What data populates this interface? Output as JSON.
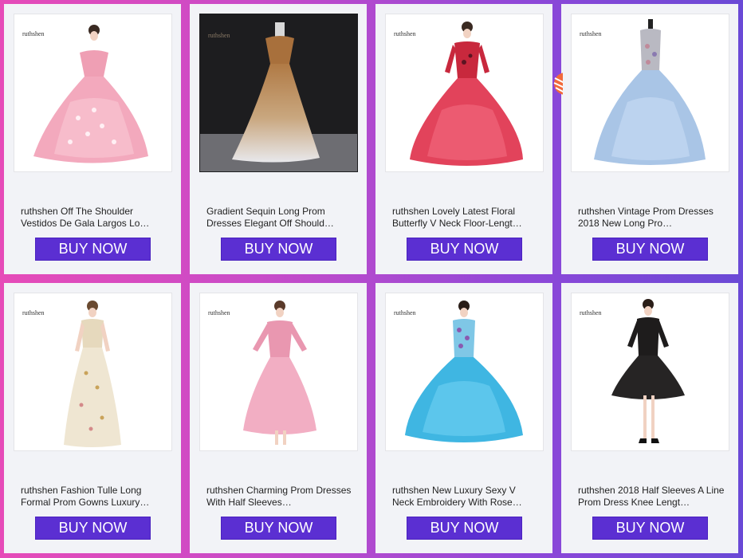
{
  "colors": {
    "button": "#5b2fd2",
    "card": "#f2f3f7",
    "background_left": "#e64bb8",
    "background_right": "#6a49d6"
  },
  "products": [
    {
      "brand": "ruthshen",
      "title": "ruthshen Off The Shoulder Vestidos De Gala Largos Lo…",
      "button": "BUY NOW",
      "dress": "pink-ball-gown"
    },
    {
      "brand": "ruthshen",
      "title": "Gradient Sequin Long Prom Dresses Elegant Off Should…",
      "button": "BUY NOW",
      "dress": "gold-silver-sequin-gown"
    },
    {
      "brand": "ruthshen",
      "title": "ruthshen Lovely Latest Floral Butterfly V Neck Floor-Lengt…",
      "button": "BUY NOW",
      "dress": "red-ball-gown"
    },
    {
      "brand": "ruthshen",
      "title": "ruthshen Vintage Prom Dresses 2018 New Long Pro…",
      "button": "BUY NOW",
      "dress": "light-blue-gown"
    },
    {
      "brand": "ruthshen",
      "title": "ruthshen Fashion Tulle Long Formal Prom Gowns Luxury…",
      "button": "BUY NOW",
      "dress": "champagne-floral-gown"
    },
    {
      "brand": "ruthshen",
      "title": "ruthshen Charming Prom Dresses With Half Sleeves…",
      "button": "BUY NOW",
      "dress": "pink-tea-length-dress"
    },
    {
      "brand": "ruthshen",
      "title": "ruthshen New Luxury Sexy V Neck Embroidery With Rose…",
      "button": "BUY NOW",
      "dress": "turquoise-ball-gown"
    },
    {
      "brand": "ruthshen",
      "title": "ruthshen 2018 Half Sleeves A Line Prom Dress Knee Lengt…",
      "button": "BUY NOW",
      "dress": "black-lace-dress"
    }
  ]
}
